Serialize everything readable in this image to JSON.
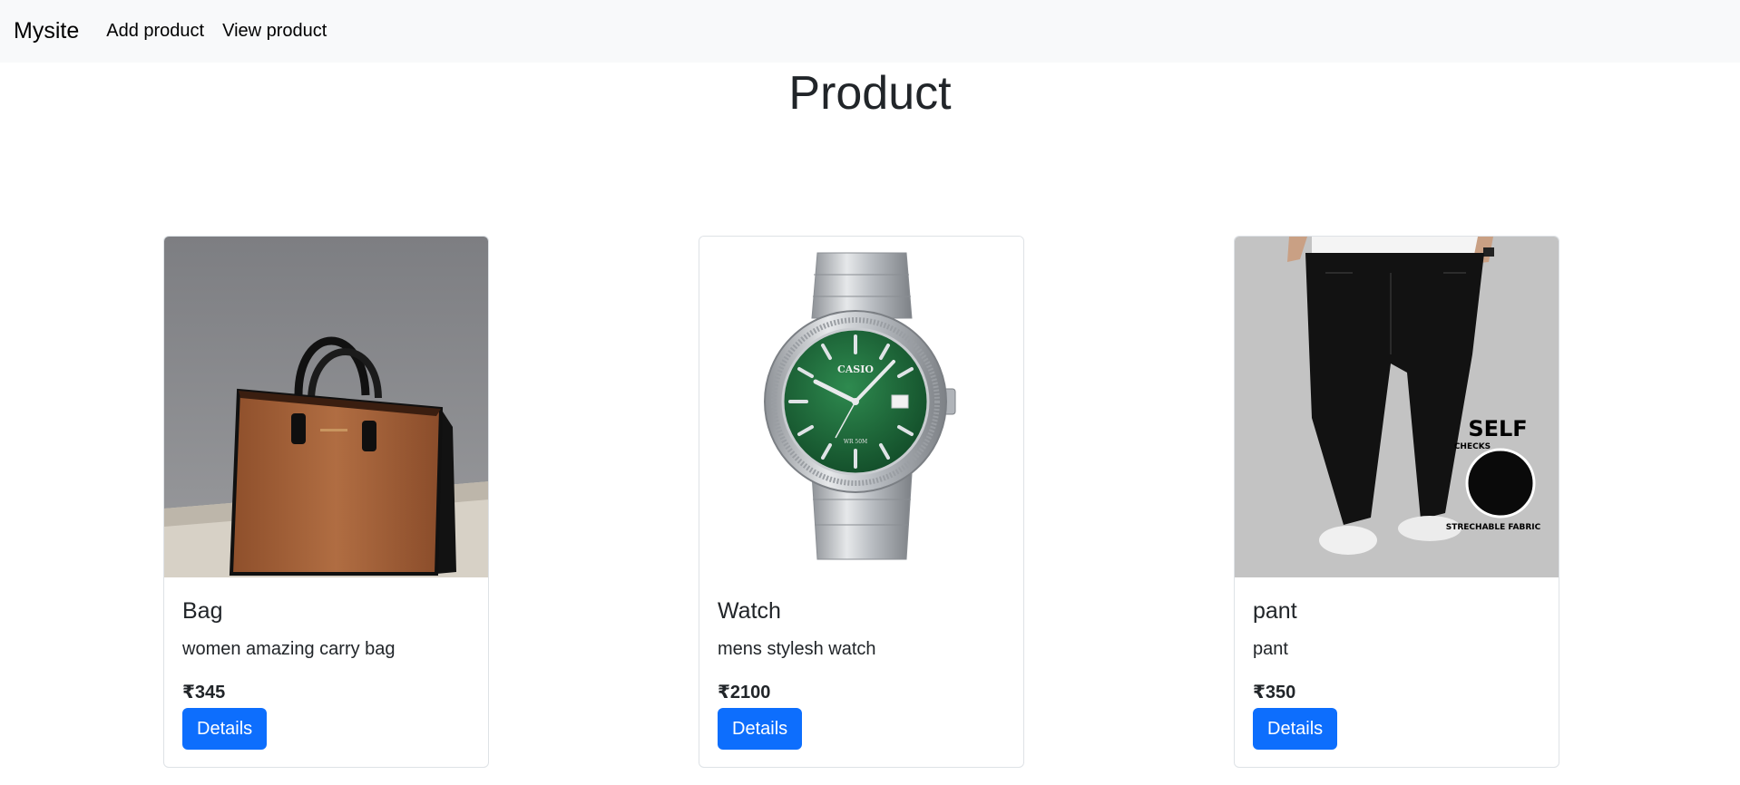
{
  "navbar": {
    "brand": "Mysite",
    "links": [
      "Add product",
      "View product"
    ]
  },
  "page": {
    "title": "Product"
  },
  "products": [
    {
      "name": "Bag",
      "description": "women amazing carry bag",
      "price": "₹345",
      "button": "Details",
      "image_icon": "handbag-image"
    },
    {
      "name": "Watch",
      "description": "mens stylesh watch",
      "price": "₹2100",
      "button": "Details",
      "image_icon": "wristwatch-image",
      "image_text": [
        "CASIO",
        "WR 50M"
      ]
    },
    {
      "name": "pant",
      "description": "pant",
      "price": "₹350",
      "button": "Details",
      "image_icon": "trousers-image",
      "image_text": [
        "SELF",
        "CHECKS",
        "STRECHABLE FABRIC"
      ]
    }
  ],
  "colors": {
    "button": "#0d6efd",
    "navbar_bg": "#f8f9fa",
    "watch_dial": "#1f6b3a",
    "bag_leather": "#a8643a"
  }
}
